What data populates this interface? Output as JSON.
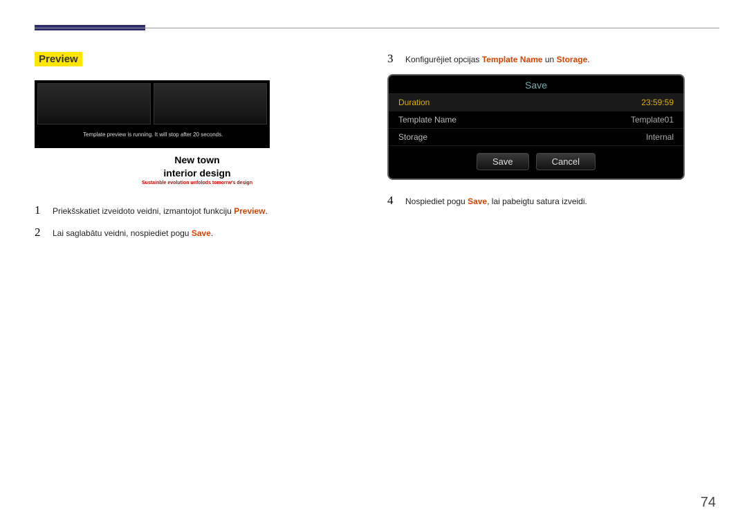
{
  "section_title": "Preview",
  "preview": {
    "running_msg": "Template preview is running. It will stop after 20 seconds.",
    "title_line1": "New town",
    "title_line2": "interior design",
    "subtitle": "Sustainble evolution unfolods tomorrw's design"
  },
  "steps_left": [
    {
      "num": "1",
      "text_before": "Priekšskatiet izveidoto veidni, izmantojot funkciju ",
      "hl": "Preview",
      "text_after": "."
    },
    {
      "num": "2",
      "text_before": "Lai saglabātu veidni, nospiediet pogu ",
      "hl": "Save",
      "text_after": "."
    }
  ],
  "steps_right": [
    {
      "num": "3",
      "t1": "Konfigurējiet opcijas ",
      "h1": "Template Name",
      "t2": " un ",
      "h2": "Storage",
      "t3": "."
    },
    {
      "num": "4",
      "t1": "Nospiediet pogu ",
      "h1": "Save",
      "t2": ", lai pabeigtu satura izveidi.",
      "h2": "",
      "t3": ""
    }
  ],
  "dialog": {
    "title": "Save",
    "rows": [
      {
        "label": "Duration",
        "value": "23:59:59",
        "selected": true
      },
      {
        "label": "Template Name",
        "value": "Template01",
        "selected": false
      },
      {
        "label": "Storage",
        "value": "Internal",
        "selected": false
      }
    ],
    "save": "Save",
    "cancel": "Cancel"
  },
  "page_number": "74"
}
